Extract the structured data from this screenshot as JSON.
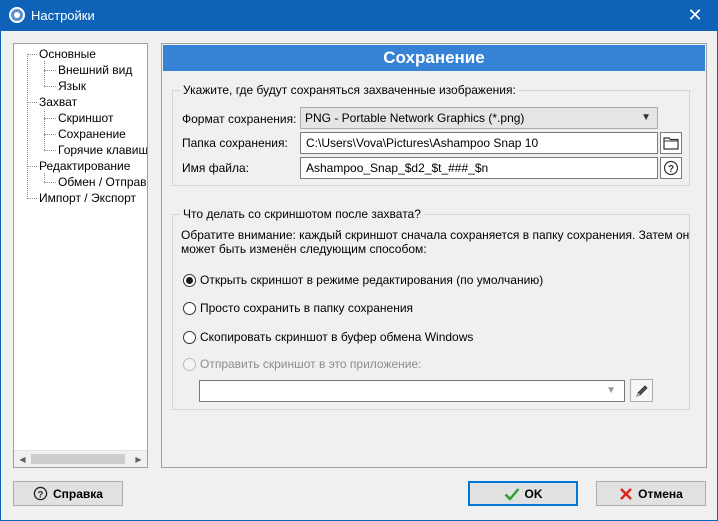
{
  "window": {
    "title": "Настройки",
    "close_glyph": "✕"
  },
  "tree": {
    "items": [
      {
        "label": "Основные"
      },
      {
        "label": "Внешний вид"
      },
      {
        "label": "Язык"
      },
      {
        "label": "Захват"
      },
      {
        "label": "Скриншот"
      },
      {
        "label": "Сохранение"
      },
      {
        "label": "Горячие клавиши"
      },
      {
        "label": "Редактирование"
      },
      {
        "label": "Обмен / Отправка"
      },
      {
        "label": "Импорт / Экспорт"
      }
    ]
  },
  "panel": {
    "title": "Сохранение",
    "location_group": {
      "title": "Укажите, где будут сохраняться захваченные изображения:",
      "format_label": "Формат сохранения:",
      "format_value": "PNG - Portable Network Graphics (*.png)",
      "folder_label": "Папка сохранения:",
      "folder_value": "C:\\Users\\Vova\\Pictures\\Ashampoo Snap 10",
      "filename_label": "Имя файла:",
      "filename_value": "Ashampoo_Snap_$d2_$t_###_$n"
    },
    "after_group": {
      "title": "Что делать со скриншотом после захвата?",
      "note_line1": "Обратите внимание: каждый скриншот сначала сохраняется в папку сохранения. Затем он",
      "note_line2": "может быть изменён следующим способом:",
      "options": [
        {
          "label": "Открыть скриншот в режиме редактирования (по умолчанию)",
          "checked": true,
          "enabled": true
        },
        {
          "label": "Просто сохранить в папку сохранения",
          "checked": false,
          "enabled": true
        },
        {
          "label": "Скопировать скриншот в буфер обмена Windows",
          "checked": false,
          "enabled": true
        },
        {
          "label": "Отправить скриншот в это приложение:",
          "checked": false,
          "enabled": false
        }
      ],
      "app_value": ""
    }
  },
  "footer": {
    "help_label": "Справка",
    "ok_label": "OK",
    "cancel_label": "Отмена"
  },
  "colors": {
    "titlebar": "#0e63b8",
    "panel_header": "#3582d6",
    "ok_check": "#2e9e2e",
    "cancel_x": "#d9261c"
  }
}
